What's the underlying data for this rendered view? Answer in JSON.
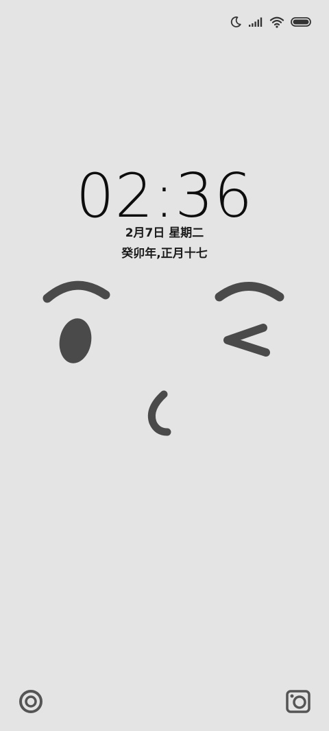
{
  "lockscreen": {
    "time": "02:36",
    "date": "2月7日 星期二",
    "lunar_date": "癸卯年,正月十七"
  },
  "status_bar": {
    "icons": [
      "moon-icon",
      "signal-icon",
      "wifi-icon",
      "battery-icon"
    ],
    "battery_level": 1.0
  },
  "shortcuts": {
    "left_icon": "target-icon",
    "right_icon": "camera-icon"
  },
  "wallpaper": {
    "subject": "winking-kiss-face-doodle",
    "stroke_color": "#4a4a4a"
  },
  "colors": {
    "background": "#e4e4e4",
    "foreground": "#111111"
  }
}
